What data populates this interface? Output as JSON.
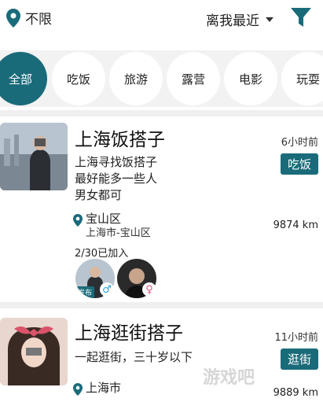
{
  "header": {
    "location": "不限",
    "sort": "离我最近"
  },
  "categories": [
    {
      "label": "全部",
      "active": true
    },
    {
      "label": "吃饭",
      "active": false
    },
    {
      "label": "旅游",
      "active": false
    },
    {
      "label": "露营",
      "active": false
    },
    {
      "label": "电影",
      "active": false
    },
    {
      "label": "玩耍",
      "active": false
    }
  ],
  "posts": [
    {
      "title": "上海饭搭子",
      "time": "6小时前",
      "tag": "吃饭",
      "desc": [
        "上海寻找饭搭子",
        "最好能多一些人",
        "男女都可"
      ],
      "address_main": "宝山区",
      "address_sub": "上海市-宝山区",
      "distance": "9874 km",
      "joined": "2/30已加入",
      "publisher_badge": "发布",
      "male_symbol": "♂",
      "female_symbol": "♀"
    },
    {
      "title": "上海逛街搭子",
      "time": "11小时前",
      "tag": "逛街",
      "desc": [
        "一起逛街，三十岁以下"
      ],
      "address_main": "上海市",
      "distance": "9889 km"
    }
  ],
  "watermark": "游戏吧",
  "colors": {
    "accent": "#1a6b7a",
    "male": "#2a9fd6",
    "female": "#e0557a"
  }
}
